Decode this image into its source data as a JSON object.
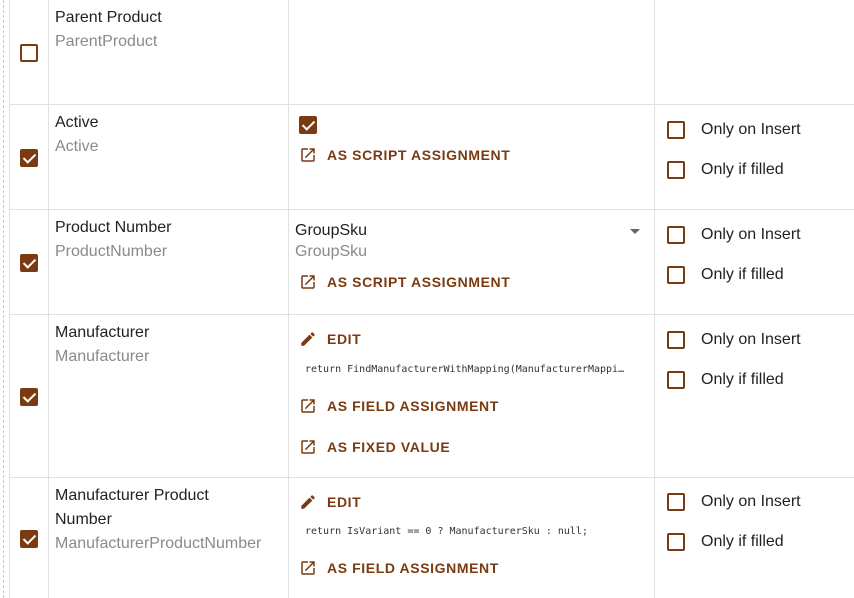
{
  "colors": {
    "accent": "#7a3a12",
    "muted_text": "#8a8a8a",
    "border": "#e0e0e0"
  },
  "rows": [
    {
      "title": "Parent Product",
      "subtitle": "ParentProduct",
      "checked": false
    },
    {
      "title": "Active",
      "subtitle": "Active",
      "checked": true,
      "value_checked": true,
      "action1": "AS SCRIPT ASSIGNMENT",
      "opt_insert": "Only on Insert",
      "opt_filled": "Only if filled"
    },
    {
      "title": "Product Number",
      "subtitle": "ProductNumber",
      "checked": true,
      "select_value": "GroupSku",
      "select_sub": "GroupSku",
      "action1": "AS SCRIPT ASSIGNMENT",
      "opt_insert": "Only on Insert",
      "opt_filled": "Only if filled"
    },
    {
      "title": "Manufacturer",
      "subtitle": "Manufacturer",
      "checked": true,
      "edit": "EDIT",
      "code": "return FindManufacturerWithMapping(ManufacturerMappi…",
      "action1": "AS FIELD ASSIGNMENT",
      "action2": "AS FIXED VALUE",
      "opt_insert": "Only on Insert",
      "opt_filled": "Only if filled"
    },
    {
      "title_line1": "Manufacturer Product",
      "title_line2": "Number",
      "subtitle": "ManufacturerProductNumber",
      "checked": true,
      "edit": "EDIT",
      "code": "return IsVariant == 0 ? ManufacturerSku : null;",
      "action1": "AS FIELD ASSIGNMENT",
      "opt_insert": "Only on Insert",
      "opt_filled": "Only if filled"
    }
  ]
}
